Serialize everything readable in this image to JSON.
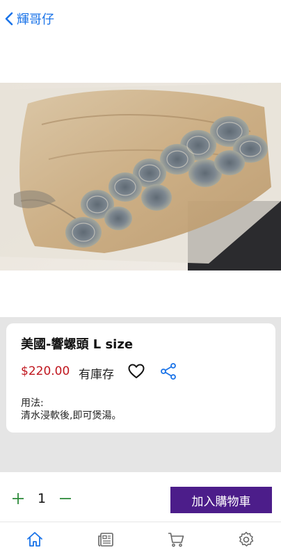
{
  "header": {
    "back_label": "輝哥仔",
    "back_icon": "chevron-left-icon"
  },
  "product": {
    "image_alt": "dried conch slices in plastic bag",
    "title": "美國-響螺頭 L size",
    "price": "$220.00",
    "stock": "有庫存",
    "usage_label": "用法:",
    "usage_text": "清水浸軟後,即可煲湯。"
  },
  "cart": {
    "quantity": "1",
    "add_button": "加入購物車"
  },
  "tabs": [
    "home-icon",
    "news-icon",
    "cart-icon",
    "settings-icon"
  ],
  "colors": {
    "accent": "#1a73e8",
    "price": "#c0161e",
    "cart_button": "#4c1d8a",
    "plus_minus": "#2e8b3a"
  }
}
